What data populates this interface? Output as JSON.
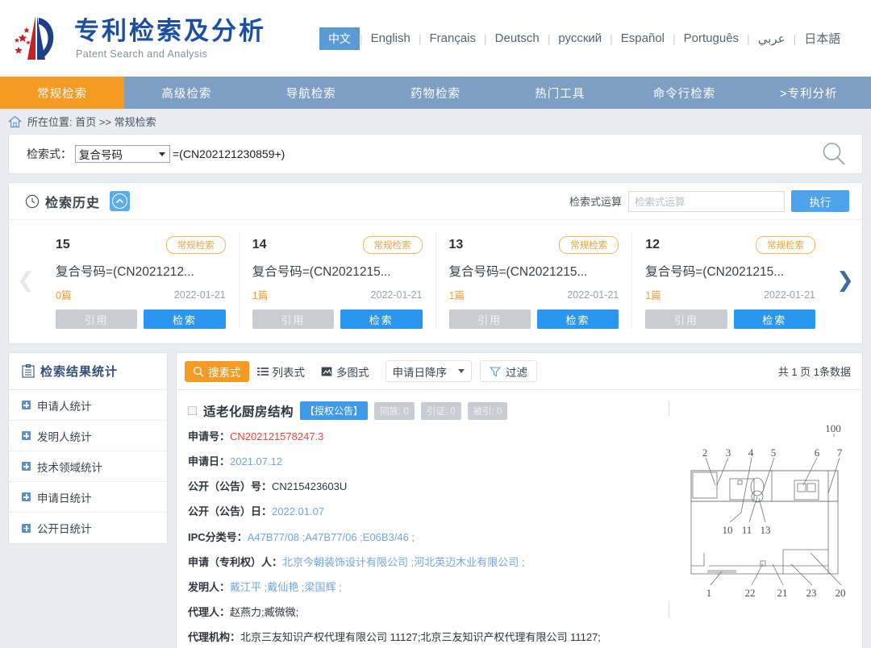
{
  "header": {
    "brand_cn": "专利检索及分析",
    "brand_en": "Patent Search and Analysis",
    "logo_icon": "patent-logo-icon",
    "languages": [
      {
        "label": "中文",
        "active": true
      },
      {
        "label": "English",
        "active": false
      },
      {
        "label": "Français",
        "active": false
      },
      {
        "label": "Deutsch",
        "active": false
      },
      {
        "label": "русский",
        "active": false
      },
      {
        "label": "Español",
        "active": false
      },
      {
        "label": "Português",
        "active": false
      },
      {
        "label": "عربي",
        "active": false
      },
      {
        "label": "日本語",
        "active": false
      }
    ]
  },
  "nav": {
    "items": [
      {
        "label": "常规检索",
        "active": true
      },
      {
        "label": "高级检索",
        "active": false
      },
      {
        "label": "导航检索",
        "active": false
      },
      {
        "label": "药物检索",
        "active": false
      },
      {
        "label": "热门工具",
        "active": false
      },
      {
        "label": "命令行检索",
        "active": false
      },
      {
        "label": ">专利分析",
        "active": false
      }
    ]
  },
  "breadcrumb": {
    "home_icon": "home-icon",
    "text": "所在位置: 首页 >> 常规检索"
  },
  "search": {
    "label": "检索式：",
    "field_selected": "复合号码",
    "expression": "=(CN202121230859+)",
    "magnifier_icon": "search-icon"
  },
  "history": {
    "clock_icon": "clock-icon",
    "title": "检索历史",
    "collapse_icon": "chevron-up-icon",
    "op_label": "检索式运算",
    "op_placeholder": "检索式运算",
    "exec_label": "执行",
    "prev_icon": "chevron-left-icon",
    "next_icon": "chevron-right-icon",
    "cards": [
      {
        "num": "15",
        "tag": "常规检索",
        "expr": "复合号码=(CN2021212...",
        "count": "0篇",
        "date": "2022-01-21",
        "cite": "引用",
        "search": "检索"
      },
      {
        "num": "14",
        "tag": "常规检索",
        "expr": "复合号码=(CN2021215...",
        "count": "1篇",
        "date": "2022-01-21",
        "cite": "引用",
        "search": "检索"
      },
      {
        "num": "13",
        "tag": "常规检索",
        "expr": "复合号码=(CN2021215...",
        "count": "1篇",
        "date": "2022-01-21",
        "cite": "引用",
        "search": "检索"
      },
      {
        "num": "12",
        "tag": "常规检索",
        "expr": "复合号码=(CN2021215...",
        "count": "1篇",
        "date": "2022-01-21",
        "cite": "引用",
        "search": "检索"
      }
    ]
  },
  "sidebar": {
    "clipboard_icon": "clipboard-icon",
    "title": "检索结果统计",
    "items": [
      {
        "label": "申请人统计"
      },
      {
        "label": "发明人统计"
      },
      {
        "label": "技术领域统计"
      },
      {
        "label": "申请日统计"
      },
      {
        "label": "公开日统计"
      }
    ]
  },
  "toolbar": {
    "view_search": "搜素式",
    "view_search_icon": "search-form-icon",
    "view_list": "列表式",
    "view_list_icon": "list-icon",
    "view_gallery": "多图式",
    "view_gallery_icon": "image-grid-icon",
    "sort_label": "申请日降序",
    "filter_label": "过滤",
    "filter_icon": "funnel-icon",
    "count_text": "共 1 页 1条数据"
  },
  "result": {
    "title": "适老化厨房结构",
    "badge_grant": "【授权公告】",
    "badge_family": "同族: 0",
    "badge_citing": "引证: 0",
    "badge_cited": "被引: 0",
    "fields": [
      {
        "key": "申请号：",
        "value": "CN202121578247.3",
        "style": "red"
      },
      {
        "key": "申请日：",
        "value": "2021.07.12",
        "style": "blue"
      },
      {
        "key": "公开（公告）号：",
        "value": "CN215423603U",
        "style": "dark"
      },
      {
        "key": "公开（公告）日：",
        "value": "2022.01.07",
        "style": "blue"
      },
      {
        "key": "IPC分类号：",
        "value": "A47B77/08 ;A47B77/06 ;E06B3/46 ;",
        "style": "blue"
      },
      {
        "key": "申请（专利权）人：",
        "value": "北京今朝装饰设计有限公司 ;河北英迈木业有限公司 ;",
        "style": "blue"
      },
      {
        "key": "发明人：",
        "value": "戴江平 ;戴仙艳 ;梁国辉 ;",
        "style": "blue"
      },
      {
        "key": "代理人：",
        "value": "赵燕力;臧微微;",
        "style": "dark"
      },
      {
        "key": "代理机构：",
        "value": "北京三友知识产权代理有限公司 11127;北京三友知识产权代理有限公司 11127;",
        "style": "dark"
      }
    ],
    "drawing": {
      "name": "patent-figure",
      "ref_main": "100",
      "labels_top": [
        "2",
        "3",
        "4",
        "5",
        "6",
        "7"
      ],
      "labels_mid": [
        "10",
        "11",
        "13"
      ],
      "labels_bottom": [
        "1",
        "22",
        "21",
        "23",
        "20"
      ]
    }
  },
  "colors": {
    "accent_orange": "#f59a23",
    "nav_blue": "#7d9fc4",
    "brand_blue": "#1c4fa0",
    "button_blue": "#2b96ef",
    "link_blue": "#6fa8dc",
    "value_red": "#e8453c"
  }
}
